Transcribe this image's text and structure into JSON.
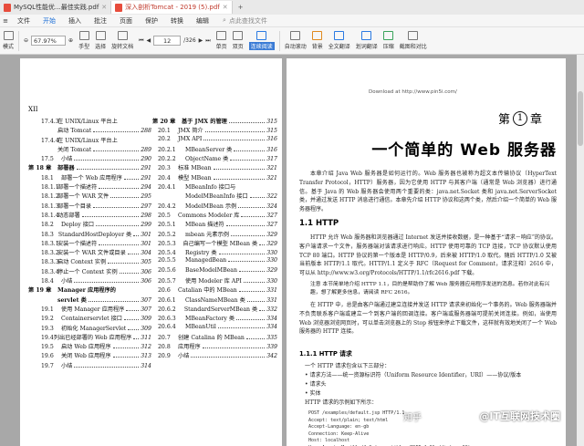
{
  "tabs": [
    {
      "label": "MySQL性能优...最佳实践.pdf",
      "active": false
    },
    {
      "label": "深入剖析Tomcat - 2019 (5).pdf",
      "active": true
    }
  ],
  "menu": {
    "items": [
      "文件",
      "开始",
      "插入",
      "批注",
      "页面",
      "保护",
      "转换",
      "编辑"
    ],
    "active_index": 1,
    "find_placeholder": "点此查找文件"
  },
  "toolbar": {
    "left_label": "模式",
    "items": [
      "手型",
      "选择",
      "旋转文档",
      "单页",
      "双页",
      "连续阅读"
    ],
    "zoom_value": "67.97%",
    "page_value": "12",
    "page_total": "/326",
    "right_items": [
      "自动滚动",
      "背景",
      "全文翻译",
      "划词翻译",
      "压缩",
      "截图和对比"
    ],
    "highlight_label": "连续阅读"
  },
  "left_page": {
    "page_number": "XII",
    "col1": [
      {
        "kind": "l1",
        "num": "17.4.3",
        "text": "在 UNIX/Linux 平台上",
        "page": ""
      },
      {
        "kind": "l1c",
        "num": "",
        "text": "启动 Tomcat",
        "page": "288"
      },
      {
        "kind": "l1",
        "num": "17.4.4",
        "text": "在 UNIX/Linux 平台上",
        "page": ""
      },
      {
        "kind": "l1c",
        "num": "",
        "text": "关闭 Tomcat",
        "page": "289"
      },
      {
        "kind": "l2",
        "num": "17.5",
        "text": "小结",
        "page": "290"
      },
      {
        "kind": "ch",
        "num": "第 18 章",
        "text": "部署器",
        "page": "291"
      },
      {
        "kind": "l2",
        "num": "18.1",
        "text": "部署一个 Web 应用程序",
        "page": "291"
      },
      {
        "kind": "l1",
        "num": "18.1.1",
        "text": "部署一个描述符",
        "page": "294"
      },
      {
        "kind": "l1",
        "num": "18.1.2",
        "text": "部署一个 WAR 文件",
        "page": "295"
      },
      {
        "kind": "l1",
        "num": "18.1.3",
        "text": "部署一个目录",
        "page": "297"
      },
      {
        "kind": "l1",
        "num": "18.1.4",
        "text": "动态部署",
        "page": "298"
      },
      {
        "kind": "l2",
        "num": "18.2",
        "text": "Deploy 接口",
        "page": "299"
      },
      {
        "kind": "l2",
        "num": "18.3",
        "text": "StandardHostDeployer 类",
        "page": "301"
      },
      {
        "kind": "l1",
        "num": "18.3.1",
        "text": "安装一个描述符",
        "page": "301"
      },
      {
        "kind": "l1",
        "num": "18.3.2",
        "text": "安装一个 WAR 文件或目录",
        "page": "304"
      },
      {
        "kind": "l1",
        "num": "18.3.3",
        "text": "启动 Context 实例",
        "page": "305"
      },
      {
        "kind": "l1",
        "num": "18.3.4",
        "text": "停止一个 Context 实例",
        "page": "306"
      },
      {
        "kind": "l2",
        "num": "18.4",
        "text": "小结",
        "page": "306"
      },
      {
        "kind": "ch",
        "num": "第 19 章",
        "text": "Manager 应用程序的",
        "page": ""
      },
      {
        "kind": "ch2",
        "num": "",
        "text": "servlet 类",
        "page": "307"
      },
      {
        "kind": "l2",
        "num": "19.1",
        "text": "使用 Manager 应用程序",
        "page": "307"
      },
      {
        "kind": "l2",
        "num": "19.2",
        "text": "Containerservlet 接口",
        "page": "309"
      },
      {
        "kind": "l2",
        "num": "19.3",
        "text": "初始化 ManagerServlet",
        "page": "309"
      },
      {
        "kind": "l2",
        "num": "19.4",
        "text": "列出已经部署的 Web 应用程序",
        "page": "311"
      },
      {
        "kind": "l2",
        "num": "19.5",
        "text": "启动 Web 应用程序",
        "page": "312"
      },
      {
        "kind": "l2",
        "num": "19.6",
        "text": "关闭 Web 应用程序",
        "page": "313"
      },
      {
        "kind": "l2",
        "num": "19.7",
        "text": "小结",
        "page": "314"
      }
    ],
    "col2": [
      {
        "kind": "ch",
        "num": "第 20 章",
        "text": "基于 JMX 的管理",
        "page": "315"
      },
      {
        "kind": "s2",
        "num": "20.1",
        "text": "JMX 简介",
        "page": "315"
      },
      {
        "kind": "s2",
        "num": "20.2",
        "text": "JMX API",
        "page": "316"
      },
      {
        "kind": "s3",
        "num": "20.2.1",
        "text": "MBeanServer 类",
        "page": "316"
      },
      {
        "kind": "s3",
        "num": "20.2.2",
        "text": "ObjectName 类",
        "page": "317"
      },
      {
        "kind": "s2",
        "num": "20.3",
        "text": "标准 MBean",
        "page": "321"
      },
      {
        "kind": "s2",
        "num": "20.4",
        "text": "模型 MBean",
        "page": "321"
      },
      {
        "kind": "s3",
        "num": "20.4.1",
        "text": "MBeanInfo 接口与",
        "page": ""
      },
      {
        "kind": "s3c",
        "num": "",
        "text": "ModelMBeanInfo 接口",
        "page": "322"
      },
      {
        "kind": "s3",
        "num": "20.4.2",
        "text": "ModelMBean 示例",
        "page": "324"
      },
      {
        "kind": "s2",
        "num": "20.5",
        "text": "Commons Modeler 库",
        "page": "327"
      },
      {
        "kind": "s3",
        "num": "20.5.1",
        "text": "MBean 描述符",
        "page": "327"
      },
      {
        "kind": "s3",
        "num": "20.5.2",
        "text": "mbean 元素示例",
        "page": "329"
      },
      {
        "kind": "s3",
        "num": "20.5.3",
        "text": "自己编写一个模型 MBean 类",
        "page": "329"
      },
      {
        "kind": "s3",
        "num": "20.5.4",
        "text": "Registry 类",
        "page": "330"
      },
      {
        "kind": "s3",
        "num": "20.5.5",
        "text": "ManagedBean",
        "page": "330"
      },
      {
        "kind": "s3",
        "num": "20.5.6",
        "text": "BaseModelMBean",
        "page": "329"
      },
      {
        "kind": "s3",
        "num": "20.5.7",
        "text": "使用 Modeler 库 API",
        "page": "330"
      },
      {
        "kind": "s2",
        "num": "20.6",
        "text": "Catalian 中的 MBean",
        "page": "331"
      },
      {
        "kind": "s3",
        "num": "20.6.1",
        "text": "ClassNameMBean 类",
        "page": "331"
      },
      {
        "kind": "s3",
        "num": "20.6.2",
        "text": "StandardServerMBean 类",
        "page": "332"
      },
      {
        "kind": "s3",
        "num": "20.6.3",
        "text": "MBeanFactory 类",
        "page": "334"
      },
      {
        "kind": "s3",
        "num": "20.6.4",
        "text": "MBeanUtil",
        "page": "334"
      },
      {
        "kind": "s2",
        "num": "20.7",
        "text": "创建 Catalina 的 MBean",
        "page": "335"
      },
      {
        "kind": "s2",
        "num": "20.8",
        "text": "应用程序",
        "page": "339"
      },
      {
        "kind": "s2",
        "num": "20.9",
        "text": "小结",
        "page": "342"
      }
    ]
  },
  "right_page": {
    "download": "Download at http://www.pin5i.com/",
    "chapter_prefix": "第",
    "chapter_number": "1",
    "chapter_suffix": "章",
    "chapter_title": "一个简单的 Web 服务器",
    "intro": "本章介绍 Java Web 服务器是如何运行的。Web 服务器也被称为超文本传输协议（HyperText Transfer Protocol，HTTP）服务器，因为它使用 HTTP 与其客户端（通常是 Web 浏览器）进行通信。基于 Java 的 Web 服务器会使用两个重要的类：java.net.Socket 类和 java.net.ServerSocket 类，并通过发送 HTTP 消息进行通信。本章先介绍 HTTP 协议和这两个类，然后介绍一个简单的 Web 服务器程序。",
    "h_http": "1.1 HTTP",
    "p_http": "HTTP 允许 Web 服务器和浏览器通过 Internet 发送并接收数据，是一种基于“请求－响应”的协议。客户端请求一个文件，服务器端对该请求进行响应。HTTP 使用可靠的 TCP 连接，TCP 协议默认使用 TCP 80 端口。HTTP 协议的第一个版本是 HTTP/0.9，后来被 HTTP/1.0 取代。随后 HTTP/1.0 又被当前版本 HTTP/1.1 取代。HTTP/1.1 定义于 RFC（Request for Comment，请求注释）2616 中，可以从 http://www.w3.org/Protocols/HTTP/1.1/rfc2616.pdf 下载。",
    "note": "注意  本节简单地介绍 HTTP 1.1，目的是帮助你了解 Web 服务器应用程序发送的消息。若你对此有兴趣，想了解更多信息，请阅读 RFC 2616。",
    "p_conn": "在 HTTP 中，总是由客户端通过建立连接并发送 HTTP 请求来初始化一个事务的。Web 服务器端并不负责联系客户端或建立一个到客户端的回调连接。客户端或服务器端可提前关闭连接。例如，当使用 Web 浏览器浏览网页时，可以单击浏览器上的 Stop 按钮来停止下载文件，这样就有效地关闭了一个 Web 服务器的 HTTP 连接。",
    "h_req": "1.1.1 HTTP 请求",
    "req_intro": "一个 HTTP 请求包含以下三部分：",
    "req_items": [
      "请求方法——统一资源标识符（Uniform Resource Identifier，URI）——协议/版本",
      "请求头",
      "实体"
    ],
    "req_example": "HTTP 请求的示例如下所示：",
    "code": "POST /examples/default.jsp HTTP/1.1\nAccept: text/plain; text/html\nAccept-Language: en-gb\nConnection: Keep-Alive\nHost: localhost\nUser-Agent: Mozilla/4.0 (compatible; MSIE 4.01; Windows 98)"
  },
  "watermark": {
    "site": "知乎",
    "author": "@IT互联网技术圈"
  }
}
